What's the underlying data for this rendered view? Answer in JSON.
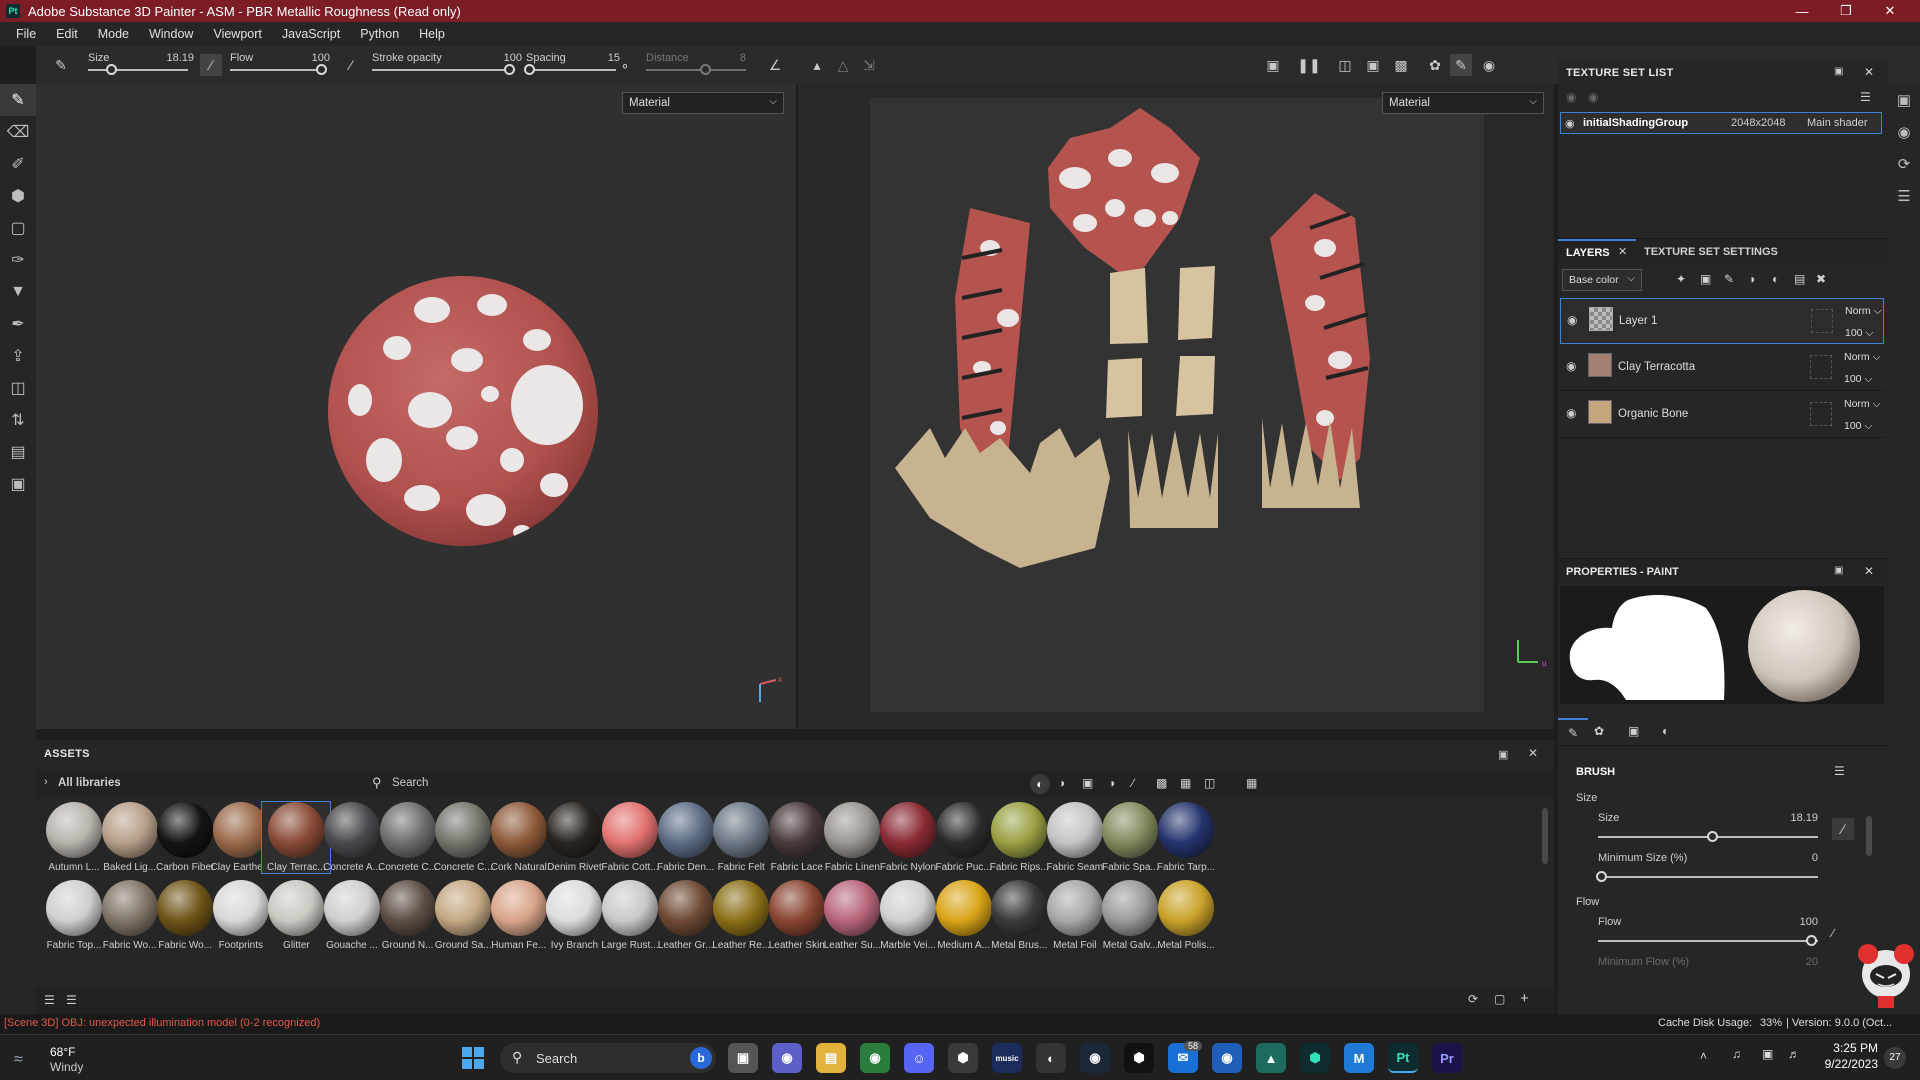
{
  "window": {
    "title": "Adobe Substance 3D Painter - ASM - PBR Metallic Roughness (Read only)",
    "logo": "Pt"
  },
  "menu": [
    "File",
    "Edit",
    "Mode",
    "Window",
    "Viewport",
    "JavaScript",
    "Python",
    "Help"
  ],
  "tool_options": {
    "size": {
      "label": "Size",
      "value": "18.19",
      "fraction": 0.2
    },
    "flow": {
      "label": "Flow",
      "value": "100",
      "fraction": 1.0
    },
    "stroke_opacity": {
      "label": "Stroke opacity",
      "value": "100",
      "fraction": 1.0
    },
    "spacing": {
      "label": "Spacing",
      "value": "15",
      "fraction": 0.0
    },
    "distance": {
      "label": "Distance",
      "value": "8",
      "fraction": 0.6
    }
  },
  "viewport3d": {
    "channel": "Material"
  },
  "viewport2d": {
    "channel": "Material"
  },
  "texture_set_list": {
    "title": "TEXTURE SET LIST",
    "item": {
      "name": "initialShadingGroup",
      "resolution": "2048x2048",
      "shader": "Main shader"
    }
  },
  "layers_panel": {
    "tabs": [
      "LAYERS",
      "TEXTURE SET SETTINGS"
    ],
    "channel": "Base color",
    "layers": [
      {
        "name": "Layer 1",
        "blend": "Norm",
        "opacity": "100"
      },
      {
        "name": "Clay Terracotta",
        "blend": "Norm",
        "opacity": "100"
      },
      {
        "name": "Organic Bone",
        "blend": "Norm",
        "opacity": "100"
      }
    ]
  },
  "properties": {
    "title": "PROPERTIES - PAINT",
    "section": "BRUSH",
    "size_group": "Size",
    "size": {
      "label": "Size",
      "value": "18.19",
      "fraction": 0.53
    },
    "min_size": {
      "label": "Minimum Size (%)",
      "value": "0",
      "fraction": 0.0
    },
    "flow_group": "Flow",
    "flow": {
      "label": "Flow",
      "value": "100",
      "fraction": 1.0
    },
    "min_flow": {
      "label": "Minimum Flow (%)",
      "value": "20"
    }
  },
  "assets": {
    "title": "ASSETS",
    "library": "All libraries",
    "search_placeholder": "Search",
    "row1": [
      {
        "name": "Autumn L...",
        "color": "#b9b3ad"
      },
      {
        "name": "Baked Lig...",
        "color": "#b79f89"
      },
      {
        "name": "Carbon Fiber",
        "color": "#141414"
      },
      {
        "name": "Clay Earthe...",
        "color": "#9b6a4b"
      },
      {
        "name": "Clay Terrac...",
        "color": "#8a4b38"
      },
      {
        "name": "Concrete A...",
        "color": "#4a4a4e"
      },
      {
        "name": "Concrete C...",
        "color": "#6e6e6e"
      },
      {
        "name": "Concrete C...",
        "color": "#76766e"
      },
      {
        "name": "Cork Natural",
        "color": "#8e5a39"
      },
      {
        "name": "Denim Rivet",
        "color": "#2a2420"
      },
      {
        "name": "Fabric Cott...",
        "color": "#e27270"
      },
      {
        "name": "Fabric Den...",
        "color": "#5d6d86"
      },
      {
        "name": "Fabric Felt",
        "color": "#6e7887"
      },
      {
        "name": "Fabric Lace",
        "color": "#4a3a3c"
      },
      {
        "name": "Fabric Linen",
        "color": "#9a9692"
      },
      {
        "name": "Fabric Nylon",
        "color": "#8a2a34"
      },
      {
        "name": "Fabric Puc...",
        "color": "#2c2c2c"
      },
      {
        "name": "Fabric Rips...",
        "color": "#9aa043"
      },
      {
        "name": "Fabric Seam",
        "color": "#c4c4c4"
      },
      {
        "name": "Fabric Spa...",
        "color": "#818a5e"
      },
      {
        "name": "Fabric Tarp...",
        "color": "#25346e"
      }
    ],
    "row2": [
      {
        "name": "Fabric Top...",
        "color": "#cfcfcf"
      },
      {
        "name": "Fabric Wo...",
        "color": "#807567"
      },
      {
        "name": "Fabric Wo...",
        "color": "#6f5418"
      },
      {
        "name": "Footprints",
        "color": "#d8d8d8"
      },
      {
        "name": "Glitter",
        "color": "#c9c9c2"
      },
      {
        "name": "Gouache ...",
        "color": "#cfcfcf"
      },
      {
        "name": "Ground N...",
        "color": "#5d4e44"
      },
      {
        "name": "Ground Sa...",
        "color": "#c4a883"
      },
      {
        "name": "Human Fe...",
        "color": "#d8a48a"
      },
      {
        "name": "Ivy Branch",
        "color": "#dcdcdc"
      },
      {
        "name": "Large Rust...",
        "color": "#c9c9c9"
      },
      {
        "name": "Leather Gr...",
        "color": "#6e4a35"
      },
      {
        "name": "Leather Re...",
        "color": "#8c7018"
      },
      {
        "name": "Leather Skin",
        "color": "#8a4532"
      },
      {
        "name": "Leather Su...",
        "color": "#b8667a"
      },
      {
        "name": "Marble Vei...",
        "color": "#d0d0d0"
      },
      {
        "name": "Medium A...",
        "color": "#d9a418"
      },
      {
        "name": "Metal Brus...",
        "color": "#3a3a3a"
      },
      {
        "name": "Metal Foil",
        "color": "#a8a8a8"
      },
      {
        "name": "Metal Galv...",
        "color": "#9a9a9a"
      },
      {
        "name": "Metal Polis...",
        "color": "#c9a22a"
      }
    ]
  },
  "status": {
    "error": "[Scene 3D] OBJ: unexpected illumination model (0-2 recognized)",
    "cache_label": "Cache Disk Usage:",
    "cache_value": "33%",
    "version": "| Version: 9.0.0 (Oct..."
  },
  "taskbar": {
    "weather_temp": "68°F",
    "weather_desc": "Windy",
    "search": "Search",
    "time": "3:25 PM",
    "date": "9/22/2023",
    "notif_count": "27",
    "mail_badge": "58"
  },
  "colors": {
    "titlebar": "#7c1c24",
    "accent": "#3d82d6",
    "error": "#e05a4a"
  }
}
